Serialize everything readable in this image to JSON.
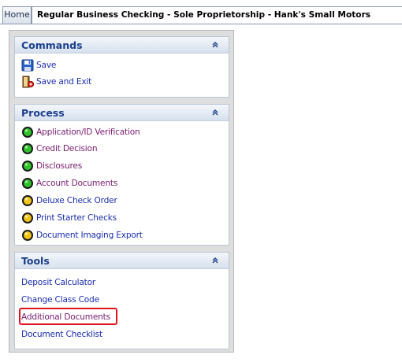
{
  "tabs": {
    "home": "Home",
    "active": "Regular Business Checking - Sole Proprietorship - Hank's Small Motors"
  },
  "commands": {
    "title": "Commands",
    "items": [
      {
        "label": "Save",
        "icon": "floppy-disk-icon"
      },
      {
        "label": "Save and Exit",
        "icon": "exit-door-icon"
      }
    ]
  },
  "process": {
    "title": "Process",
    "items": [
      {
        "label": "Application/ID Verification",
        "status": "green"
      },
      {
        "label": "Credit Decision",
        "status": "green"
      },
      {
        "label": "Disclosures",
        "status": "green"
      },
      {
        "label": "Account Documents",
        "status": "green"
      },
      {
        "label": "Deluxe Check Order",
        "status": "yellow"
      },
      {
        "label": "Print Starter Checks",
        "status": "yellow"
      },
      {
        "label": "Document Imaging Export",
        "status": "yellow"
      }
    ]
  },
  "tools": {
    "title": "Tools",
    "items": [
      {
        "label": "Deposit Calculator"
      },
      {
        "label": "Change Class Code"
      },
      {
        "label": "Additional Documents",
        "highlighted": true
      },
      {
        "label": "Document Checklist"
      }
    ]
  },
  "colors": {
    "panel_title": "#1b3f8b",
    "link": "#1a2fb0",
    "visited_link": "#7a1b70",
    "status_green": "#2fc22b",
    "status_yellow": "#f2c418",
    "highlight_border": "#e0141e"
  }
}
